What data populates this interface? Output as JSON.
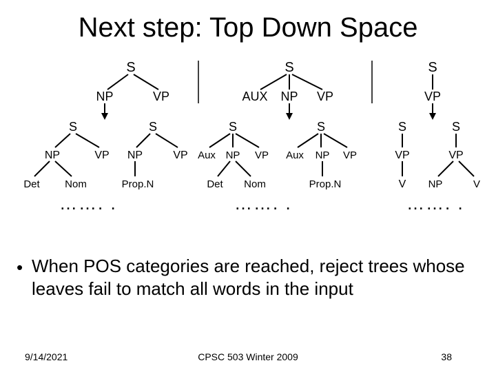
{
  "title": "Next step: Top Down Space",
  "bullet": "When POS categories are reached, reject trees whose leaves fail to match all words in the input",
  "footer": {
    "date": "9/14/2021",
    "course": "CPSC 503 Winter 2009",
    "page": "38"
  },
  "ellipsis": "……. .",
  "trees": {
    "row1": [
      {
        "root": "S",
        "children": [
          "NP",
          "VP"
        ]
      },
      {
        "root": "S",
        "children": [
          "AUX",
          "NP",
          "VP"
        ]
      },
      {
        "root": "S",
        "children": [
          "VP"
        ]
      }
    ],
    "row2": [
      {
        "root": "S",
        "mid": [
          "NP",
          "VP"
        ],
        "leaves": [
          "Det",
          "Nom"
        ]
      },
      {
        "root": "S",
        "mid": [
          "NP",
          "VP"
        ],
        "leaves": [
          "Prop.N"
        ]
      },
      {
        "root": "S",
        "mid": [
          "Aux",
          "NP",
          "VP"
        ],
        "leaves": [
          "Det",
          "Nom"
        ]
      },
      {
        "root": "S",
        "mid": [
          "Aux",
          "NP",
          "VP"
        ],
        "leaves": [
          "Prop.N"
        ]
      },
      {
        "root": "S",
        "mid": [
          "VP"
        ],
        "leaves": [
          "V"
        ]
      },
      {
        "root": "S",
        "mid": [
          "VP"
        ],
        "leaves": [
          "NP",
          "V"
        ]
      }
    ]
  }
}
